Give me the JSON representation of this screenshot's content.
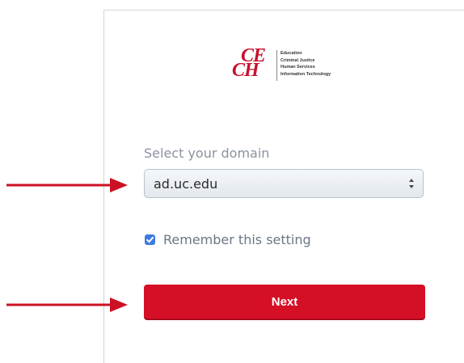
{
  "logo": {
    "mark_line1": "CE",
    "mark_line2": "CH",
    "words": [
      "Education",
      "Criminal Justice",
      "Human Services",
      "Information Technology"
    ]
  },
  "domain": {
    "label": "Select your domain",
    "selected": "ad.uc.edu"
  },
  "remember": {
    "label": "Remember this setting",
    "checked": true
  },
  "next_button": {
    "label": "Next"
  },
  "colors": {
    "brand_red": "#d50f26",
    "annotation_arrow": "#cc1124",
    "checkbox_blue": "#3d7be0"
  },
  "icons": {
    "select_arrows": "updown-chevrons-icon",
    "checkbox": "checkmark-icon",
    "annotation": "arrow-right-icon"
  }
}
